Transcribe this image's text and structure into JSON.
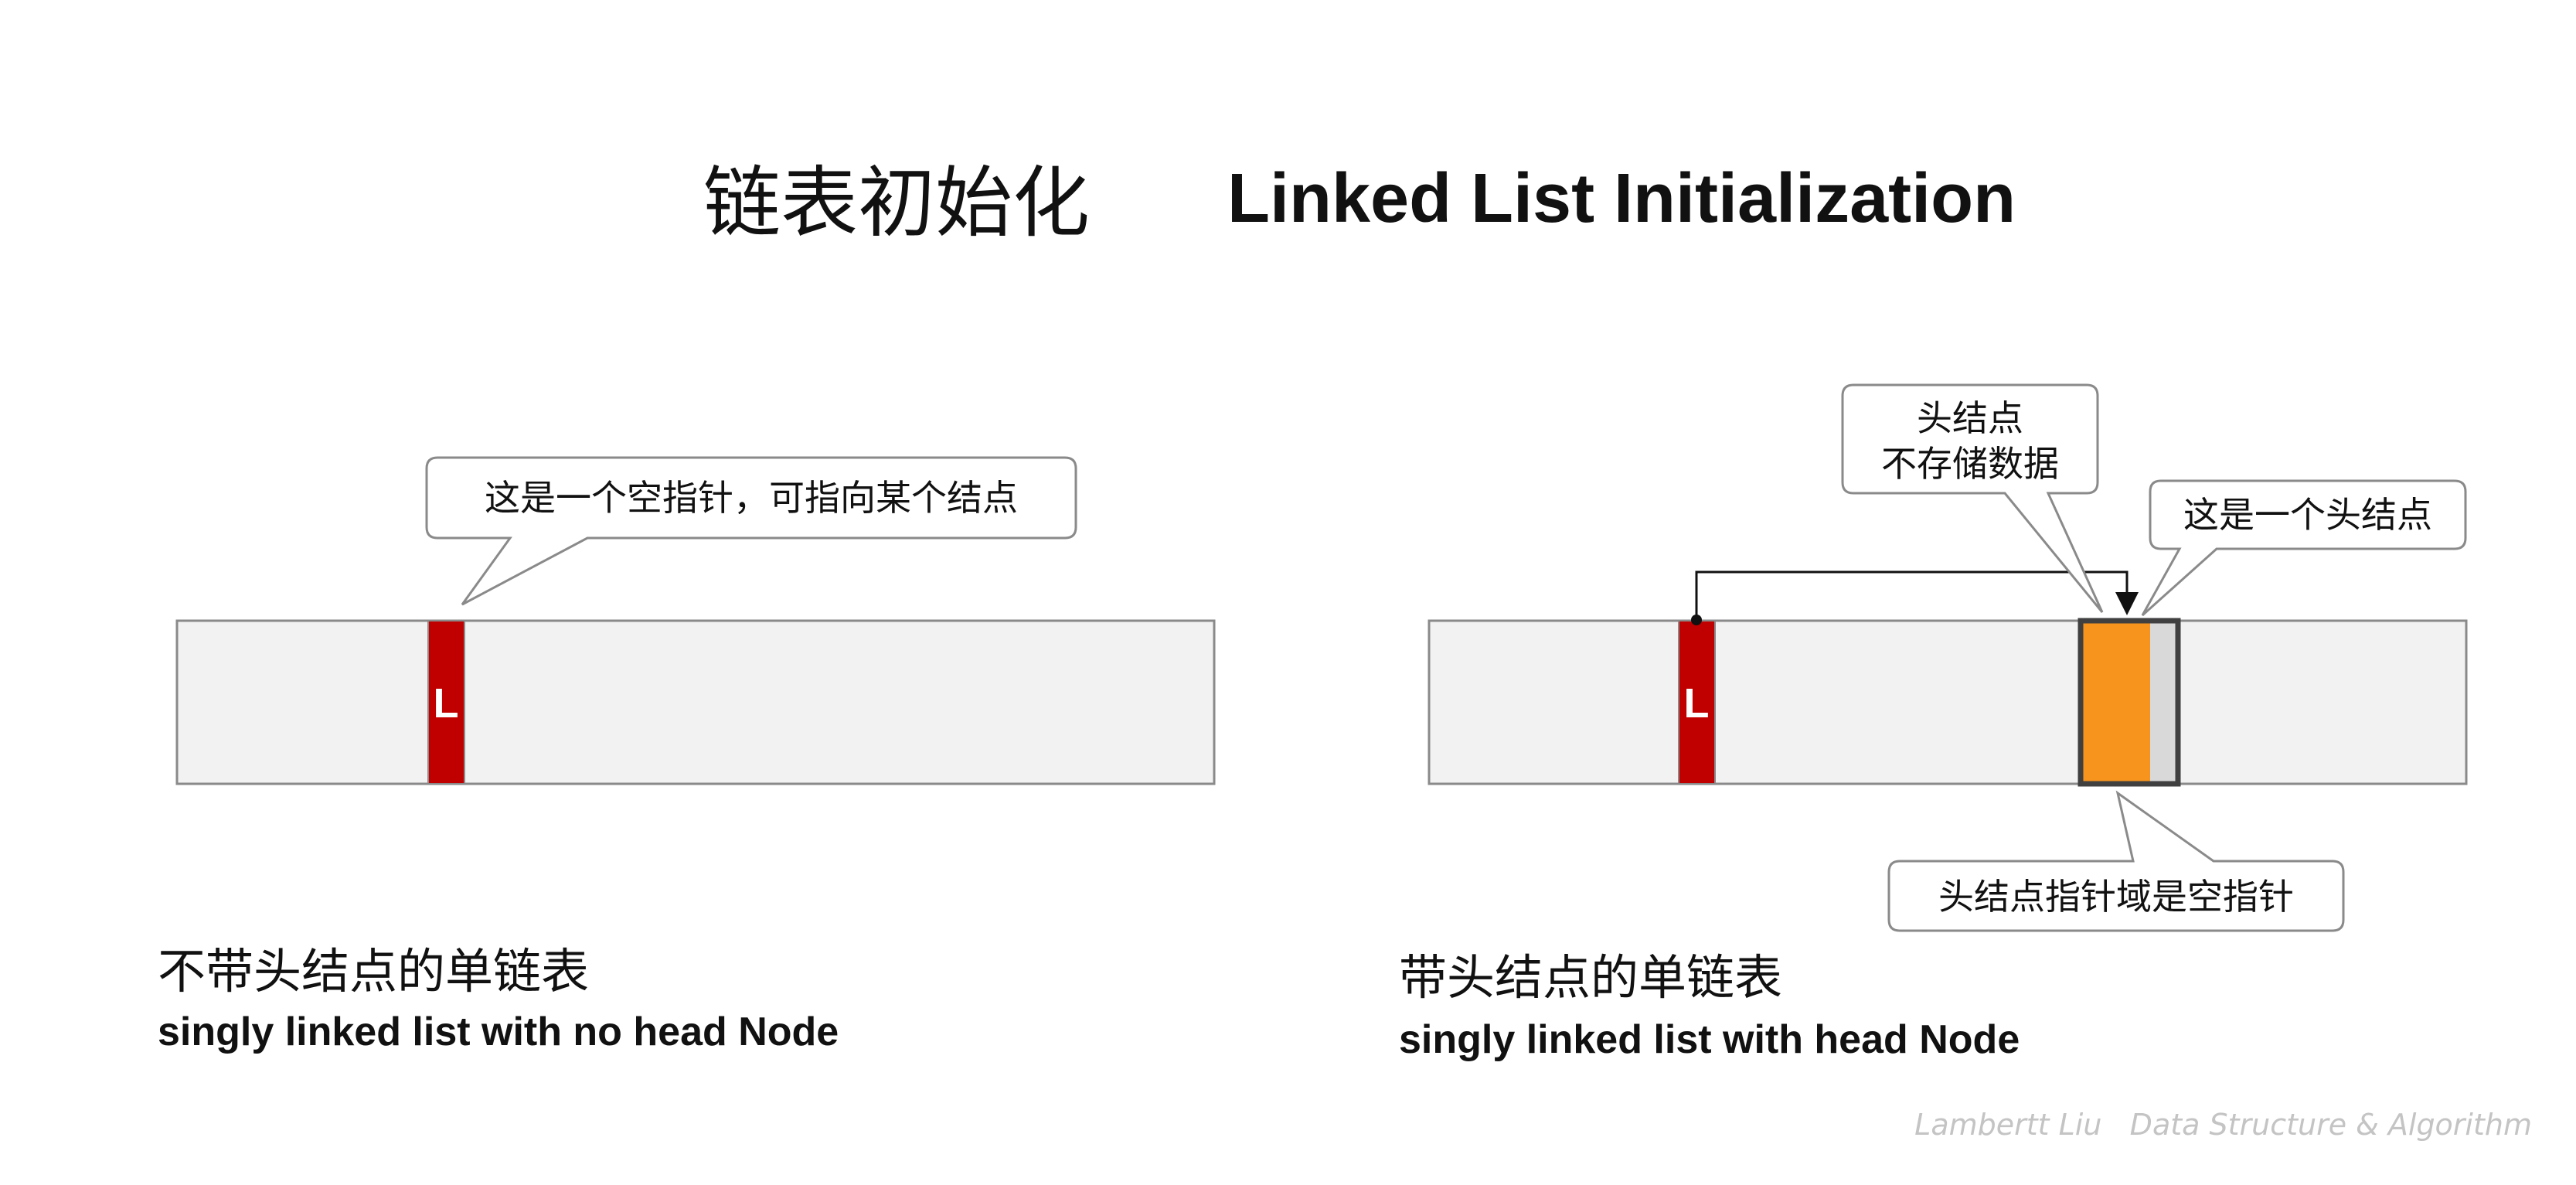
{
  "title": {
    "zh": "链表初始化",
    "en": "Linked List Initialization"
  },
  "left_panel": {
    "pointer_label": "L",
    "callout": "这是一个空指针，可指向某个结点",
    "caption_zh": "不带头结点的单链表",
    "caption_en": "singly linked list with no head Node"
  },
  "right_panel": {
    "pointer_label": "L",
    "callout_head_line1": "头结点",
    "callout_head_line2": "不存储数据",
    "callout_is_head": "这是一个头结点",
    "callout_null_ptr": "头结点指针域是空指针",
    "caption_zh": "带头结点的单链表",
    "caption_en": "singly linked list with head Node"
  },
  "watermark": "Lambertt Liu   Data Structure & Algorithm",
  "colors": {
    "pointer_fill": "#c00000",
    "head_data_fill": "#f7941d",
    "head_ptr_fill": "#d9d9d9",
    "memory_fill": "#f2f2f2",
    "arrow": "#111111"
  }
}
